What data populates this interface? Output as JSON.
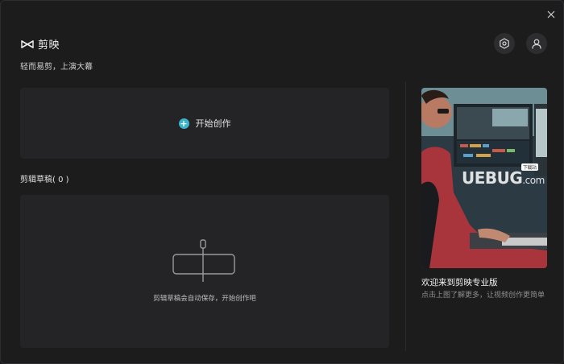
{
  "app": {
    "name": "剪映",
    "slogan": "轻而易剪，上演大幕"
  },
  "header": {
    "settings_icon": "hexagon-settings-icon",
    "user_icon": "user-icon",
    "close_icon": "close-icon"
  },
  "start": {
    "label": "开始创作"
  },
  "drafts": {
    "title": "剪辑草稿( 0 )",
    "empty_hint": "剪辑草稿会自动保存，开始创作吧"
  },
  "promo": {
    "title": "欢迎来到剪映专业版",
    "description": "点击上图了解更多，让视频创作更简单",
    "watermark_main": "UEBUG",
    "watermark_suffix": ".com",
    "watermark_tag": "下载站"
  },
  "colors": {
    "accent": "#3bb3c9",
    "background": "#1c1c1d",
    "panel": "#242426"
  }
}
